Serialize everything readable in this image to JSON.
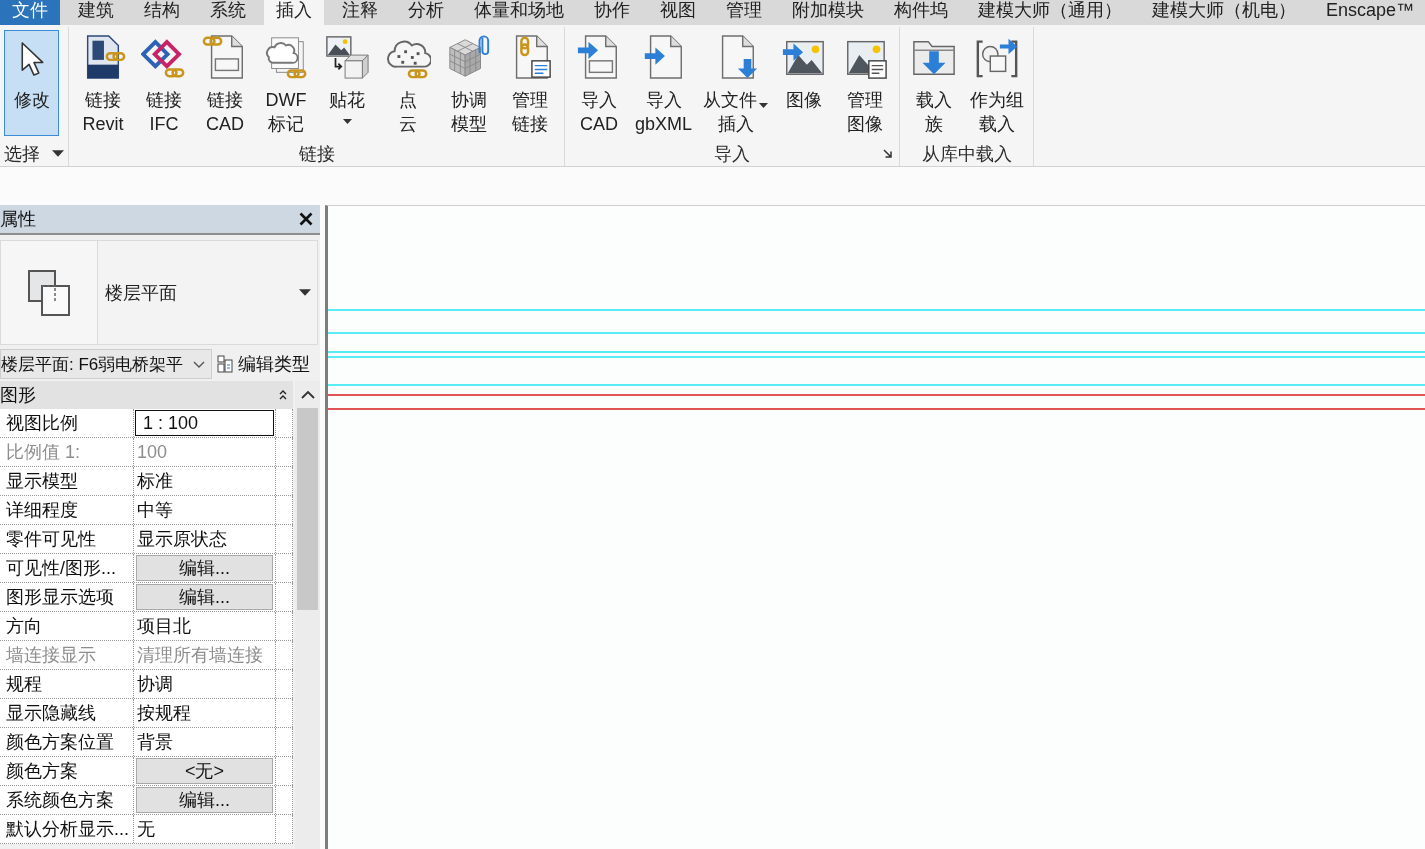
{
  "ribbon_tabs": [
    {
      "label": "文件",
      "kind": "file",
      "selected": false
    },
    {
      "label": "建筑",
      "kind": "tab",
      "selected": false
    },
    {
      "label": "结构",
      "kind": "tab",
      "selected": false
    },
    {
      "label": "系统",
      "kind": "tab",
      "selected": false
    },
    {
      "label": "插入",
      "kind": "tab",
      "selected": true
    },
    {
      "label": "注释",
      "kind": "tab",
      "selected": false
    },
    {
      "label": "分析",
      "kind": "tab",
      "selected": false
    },
    {
      "label": "体量和场地",
      "kind": "tab",
      "selected": false
    },
    {
      "label": "协作",
      "kind": "tab",
      "selected": false
    },
    {
      "label": "视图",
      "kind": "tab",
      "selected": false
    },
    {
      "label": "管理",
      "kind": "tab",
      "selected": false
    },
    {
      "label": "附加模块",
      "kind": "tab",
      "selected": false
    },
    {
      "label": "构件坞",
      "kind": "tab",
      "selected": false
    },
    {
      "label": "建模大师（通用）",
      "kind": "tab",
      "selected": false
    },
    {
      "label": "建模大师（机电）",
      "kind": "tab",
      "selected": false
    },
    {
      "label": "Enscape™",
      "kind": "tab",
      "selected": false
    }
  ],
  "ribbon": {
    "select_panel": {
      "tool": {
        "label": "修改",
        "active": true
      },
      "label": "选择",
      "dropdown": true
    },
    "panels": [
      {
        "label": "链接",
        "launcher": false,
        "buttons": [
          {
            "lines": [
              "链接",
              "Revit"
            ],
            "dropdown": false
          },
          {
            "lines": [
              "链接",
              "IFC"
            ],
            "dropdown": false
          },
          {
            "lines": [
              "链接",
              "CAD"
            ],
            "dropdown": false
          },
          {
            "lines": [
              "DWF",
              "标记"
            ],
            "dropdown": false
          },
          {
            "lines": [
              "贴花"
            ],
            "dropdown": true
          },
          {
            "lines": [
              "点",
              "云"
            ],
            "dropdown": false
          },
          {
            "lines": [
              "协调",
              "模型"
            ],
            "dropdown": false
          },
          {
            "lines": [
              "管理",
              "链接"
            ],
            "dropdown": false
          }
        ]
      },
      {
        "label": "导入",
        "launcher": true,
        "buttons": [
          {
            "lines": [
              "导入",
              "CAD"
            ],
            "dropdown": false
          },
          {
            "lines": [
              "导入",
              "gbXML"
            ],
            "dropdown": false
          },
          {
            "lines": [
              "从文件",
              "插入"
            ],
            "dropdown": true
          },
          {
            "lines": [
              "图像"
            ],
            "dropdown": false
          },
          {
            "lines": [
              "管理",
              "图像"
            ],
            "dropdown": false
          }
        ]
      },
      {
        "label": "从库中载入",
        "launcher": false,
        "buttons": [
          {
            "lines": [
              "载入",
              "族"
            ],
            "dropdown": false
          },
          {
            "lines": [
              "作为组",
              "载入"
            ],
            "dropdown": false
          }
        ]
      }
    ]
  },
  "properties": {
    "title": "属性",
    "type_selector": {
      "name": "楼层平面"
    },
    "instance_selector": {
      "value": "楼层平面: F6弱电桥架平"
    },
    "edit_type": {
      "label": "编辑类型"
    },
    "group": {
      "name": "图形",
      "expanded": true
    },
    "rows": [
      {
        "label": "视图比例",
        "value": "1 : 100",
        "kind": "input",
        "disabled": false
      },
      {
        "label": "比例值 1:",
        "value": "100",
        "kind": "text",
        "disabled": true
      },
      {
        "label": "显示模型",
        "value": "标准",
        "kind": "text",
        "disabled": false
      },
      {
        "label": "详细程度",
        "value": "中等",
        "kind": "text",
        "disabled": false
      },
      {
        "label": "零件可见性",
        "value": "显示原状态",
        "kind": "text",
        "disabled": false
      },
      {
        "label": "可见性/图形...",
        "value": "编辑...",
        "kind": "button",
        "disabled": false
      },
      {
        "label": "图形显示选项",
        "value": "编辑...",
        "kind": "button",
        "disabled": false
      },
      {
        "label": "方向",
        "value": "项目北",
        "kind": "text",
        "disabled": false
      },
      {
        "label": "墙连接显示",
        "value": "清理所有墙连接",
        "kind": "text",
        "disabled": true
      },
      {
        "label": "规程",
        "value": "协调",
        "kind": "text",
        "disabled": false
      },
      {
        "label": "显示隐藏线",
        "value": "按规程",
        "kind": "text",
        "disabled": false
      },
      {
        "label": "颜色方案位置",
        "value": "背景",
        "kind": "text",
        "disabled": false
      },
      {
        "label": "颜色方案",
        "value": "<无>",
        "kind": "button",
        "disabled": false
      },
      {
        "label": "系统颜色方案",
        "value": "编辑...",
        "kind": "button",
        "disabled": false
      },
      {
        "label": "默认分析显示...",
        "value": "无",
        "kind": "text",
        "disabled": false
      }
    ]
  }
}
